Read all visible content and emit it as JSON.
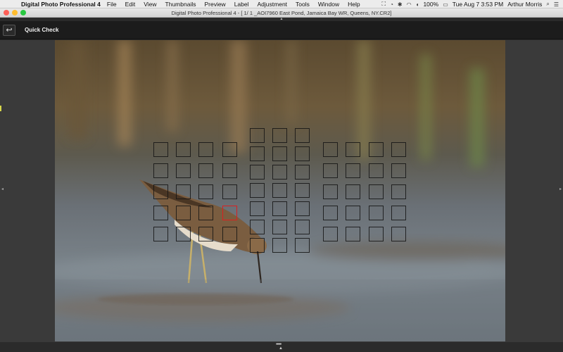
{
  "menubar": {
    "app_name": "Digital Photo Professional 4",
    "items": [
      "File",
      "Edit",
      "View",
      "Thumbnails",
      "Preview",
      "Label",
      "Adjustment",
      "Tools",
      "Window",
      "Help"
    ],
    "battery": "100%",
    "datetime": "Tue Aug 7  3:53 PM",
    "user": "Arthur Morris"
  },
  "window": {
    "title": "Digital Photo Professional 4 - [    1/    1 _AOI7960 East Pond, Jamaica Bay WR, Queens, NY.CR2]"
  },
  "toolbar": {
    "title": "Quick Check"
  },
  "bottombar": {
    "grip": "•••••"
  },
  "colors": {
    "toolbar_bg": "#1c1c1c",
    "viewer_bg": "#3a3a3a",
    "af_active": "#d92020"
  },
  "icons": [
    "apple-icon",
    "back-arrow-icon",
    "binoculars-icon",
    "wifi-icon",
    "battery-icon",
    "search-icon",
    "list-icon"
  ]
}
